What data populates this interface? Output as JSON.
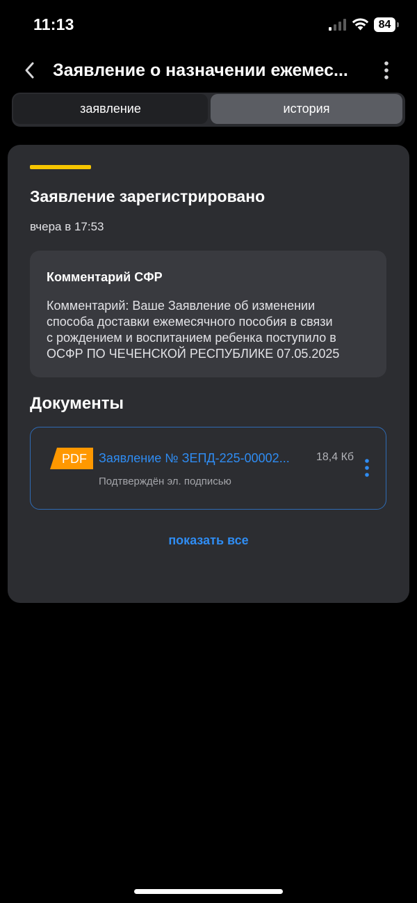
{
  "status_bar": {
    "time": "11:13",
    "battery": "84",
    "icons": [
      "signal-icon",
      "wifi-icon",
      "battery-icon"
    ]
  },
  "header": {
    "title": "Заявление о назначении ежемес...",
    "back_icon": "chevron-left-icon",
    "more_icon": "vertical-dots-icon"
  },
  "tabs": [
    {
      "label": "заявление",
      "selected": false
    },
    {
      "label": "история",
      "selected": true
    }
  ],
  "event": {
    "title": "Заявление зарегистрировано",
    "time": "вчера в 17:53",
    "accent_color": "#f7c600"
  },
  "comment": {
    "title": "Комментарий СФР",
    "lines": [
      "Комментарий: Ваше Заявление об изменении",
      "способа доставки ежемесячного пособия в связи",
      "с рождением и воспитанием ребенка поступило в",
      "ОСФР ПО ЧЕЧЕНСКОЙ РЕСПУБЛИКЕ 07.05.2025"
    ]
  },
  "documents": {
    "title": "Документы",
    "items": [
      {
        "badge": "PDF",
        "name": "Заявление № ЗЕПД-225-00002...",
        "size": "18,4 Кб",
        "status": "Подтверждён эл. подписью"
      }
    ],
    "show_all": "показать все"
  },
  "colors": {
    "background": "#000000",
    "card": "#2c2d31",
    "comment_box": "#393a3f",
    "link": "#2f8cf2",
    "pdf_badge": "#ff9800",
    "accent": "#f7c600"
  }
}
